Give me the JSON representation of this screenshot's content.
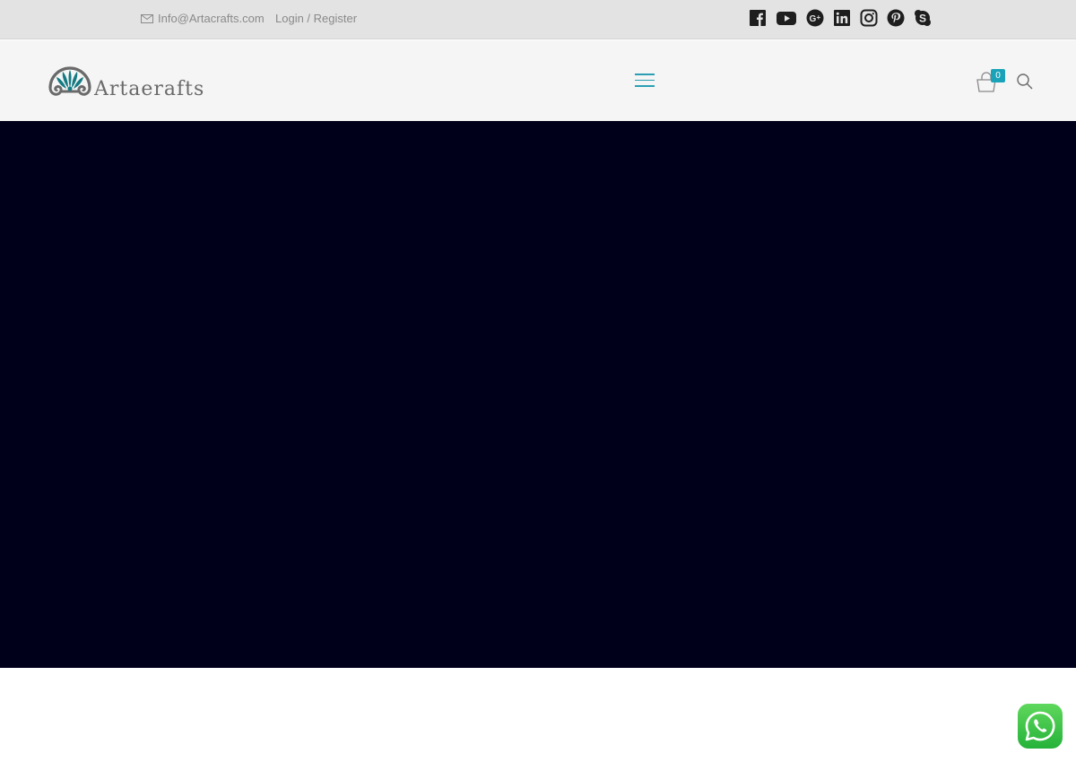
{
  "topbar": {
    "email": "Info@Artacrafts.com",
    "login": "Login / Register",
    "icons": {
      "email": "envelope-icon",
      "social": [
        "facebook-icon",
        "youtube-icon",
        "google-plus-icon",
        "linkedin-icon",
        "instagram-icon",
        "pinterest-icon",
        "skype-icon"
      ]
    }
  },
  "header": {
    "logo_text": "Artaerafts",
    "cart_count": "0",
    "icons": {
      "menu": "hamburger-menu-icon",
      "cart": "shopping-bag-icon",
      "search": "search-icon"
    }
  },
  "floating": {
    "icon": "whatsapp-icon"
  },
  "colors": {
    "accent": "#1aa3b8",
    "hero_bg": "#00001b",
    "topbar_bg": "#e3e3e3",
    "header_bg": "#f5f5f5",
    "whatsapp": "#25b23a"
  }
}
